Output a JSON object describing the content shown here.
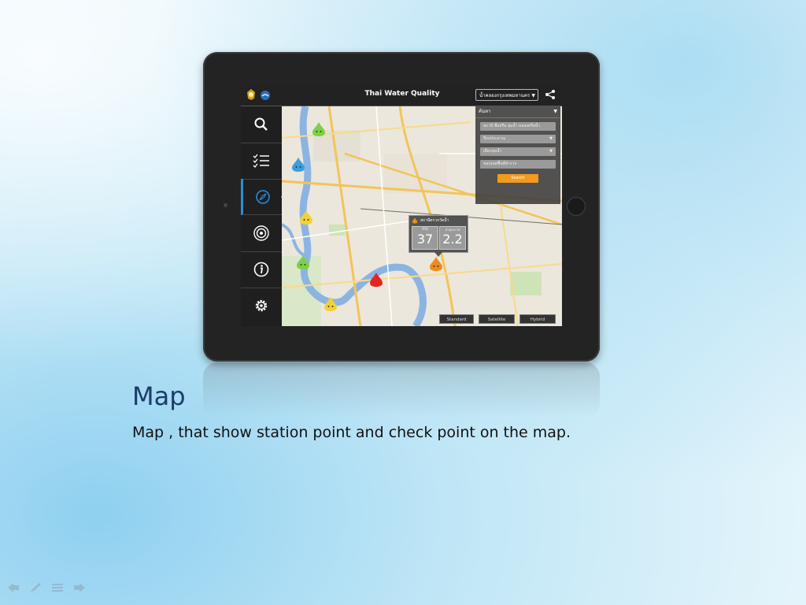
{
  "app": {
    "title": "Thai Water Quality",
    "province_select": "น้ำคลองกรุงเทพมหานคร",
    "search_panel": {
      "header": "ค้นหา",
      "fields": [
        "สถานี ชื่อหรือ ลุ่มน้ำ คลองหรือน้ำ",
        "ปีงบประมาณ",
        "เลือกลุ่มน้ำ",
        "ขอบเขตพื้นที่สำรวจ"
      ],
      "search_button": "Search"
    },
    "popup": {
      "title": "สถานีตรวจวัดน้ำ",
      "boxes": [
        {
          "label": "WQI",
          "value": "37"
        },
        {
          "label": "ค่าคุณภาพ",
          "value": "2.2"
        }
      ]
    },
    "map_types": [
      "Standard",
      "Satellite",
      "Hybrid"
    ],
    "sidebar": [
      "search-icon",
      "checklist-icon",
      "compass-icon",
      "target-icon",
      "info-icon",
      "gear-icon"
    ],
    "colors": {
      "accent": "#2a8fd8",
      "search_button": "#f29b1d",
      "heading": "#1d3a6b"
    }
  },
  "slide": {
    "heading": "Map",
    "description": "Map , that show station point and check point on the map."
  }
}
